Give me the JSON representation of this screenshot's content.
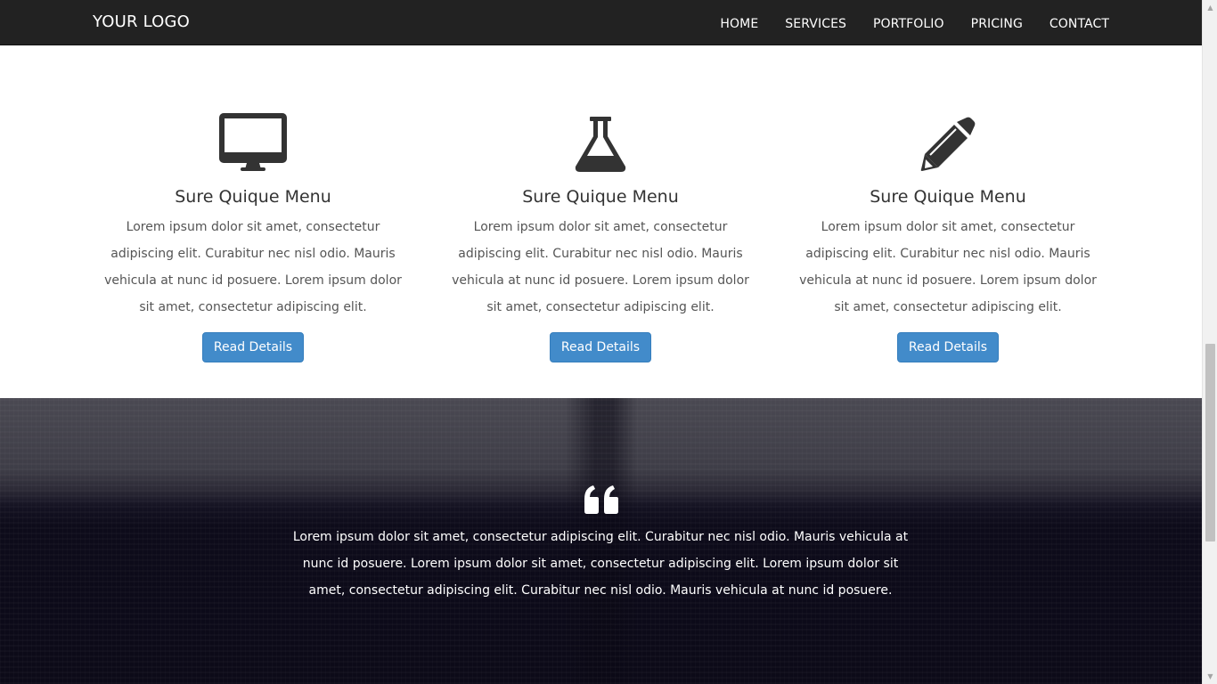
{
  "navbar": {
    "logo": "YOUR LOGO",
    "items": [
      {
        "label": "HOME"
      },
      {
        "label": "SERVICES"
      },
      {
        "label": "PORTFOLIO"
      },
      {
        "label": "PRICING"
      },
      {
        "label": "CONTACT"
      }
    ]
  },
  "services": [
    {
      "icon": "desktop-icon",
      "title": "Sure Quique Menu",
      "text": "Lorem ipsum dolor sit amet, consectetur adipiscing elit. Curabitur nec nisl odio. Mauris vehicula at nunc id posuere. Lorem ipsum dolor sit amet, consectetur adipiscing elit.",
      "button": "Read Details"
    },
    {
      "icon": "flask-icon",
      "title": "Sure Quique Menu",
      "text": "Lorem ipsum dolor sit amet, consectetur adipiscing elit. Curabitur nec nisl odio. Mauris vehicula at nunc id posuere. Lorem ipsum dolor sit amet, consectetur adipiscing elit.",
      "button": "Read Details"
    },
    {
      "icon": "pencil-icon",
      "title": "Sure Quique Menu",
      "text": "Lorem ipsum dolor sit amet, consectetur adipiscing elit. Curabitur nec nisl odio. Mauris vehicula at nunc id posuere. Lorem ipsum dolor sit amet, consectetur adipiscing elit.",
      "button": "Read Details"
    }
  ],
  "testimonial": {
    "icon": "quote-left-icon",
    "text": "Lorem ipsum dolor sit amet, consectetur adipiscing elit. Curabitur nec nisl odio. Mauris vehicula at nunc id posuere. Lorem ipsum dolor sit amet, consectetur adipiscing elit. Lorem ipsum dolor sit amet, consectetur adipiscing elit. Curabitur nec nisl odio. Mauris vehicula at nunc id posuere."
  },
  "colors": {
    "navbar_bg": "#222222",
    "button_bg": "#428bca",
    "icon_color": "#333333",
    "quote_band_bg": "#0c0a18"
  }
}
